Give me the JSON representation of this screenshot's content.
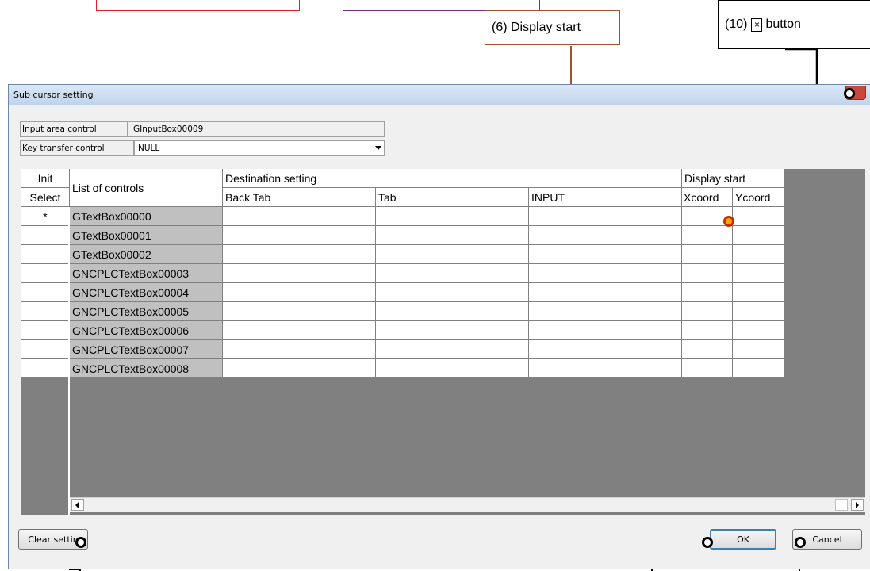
{
  "callouts": {
    "display_start": "(6) Display start",
    "close_prefix": "(10)",
    "close_symbol": "×",
    "close_suffix": "button"
  },
  "window": {
    "title": "Sub cursor setting"
  },
  "fields": {
    "input_area_label": "Input area control",
    "input_area_value": "GInputBox00009",
    "key_transfer_label": "Key transfer control",
    "key_transfer_value": "NULL"
  },
  "grid": {
    "header_init": "Init",
    "header_select": "Select",
    "header_list": "List of controls",
    "header_destination": "Destination setting",
    "header_back_tab": "Back Tab",
    "header_tab": "Tab",
    "header_input": "INPUT",
    "header_display_start": "Display start",
    "header_xcoord": "Xcoord",
    "header_ycoord": "Ycoord",
    "rows": [
      {
        "select": "*",
        "name": "GTextBox00000"
      },
      {
        "select": "",
        "name": "GTextBox00001"
      },
      {
        "select": "",
        "name": "GTextBox00002"
      },
      {
        "select": "",
        "name": "GNCPLCTextBox00003"
      },
      {
        "select": "",
        "name": "GNCPLCTextBox00004"
      },
      {
        "select": "",
        "name": "GNCPLCTextBox00005"
      },
      {
        "select": "",
        "name": "GNCPLCTextBox00006"
      },
      {
        "select": "",
        "name": "GNCPLCTextBox00007"
      },
      {
        "select": "",
        "name": "GNCPLCTextBox00008"
      }
    ]
  },
  "buttons": {
    "clear": "Clear settin",
    "ok": "OK",
    "cancel": "Cancel"
  },
  "colors": {
    "callout_6": "#a0522d",
    "callout_marker": "#ffa500",
    "grid_background": "#808080"
  }
}
